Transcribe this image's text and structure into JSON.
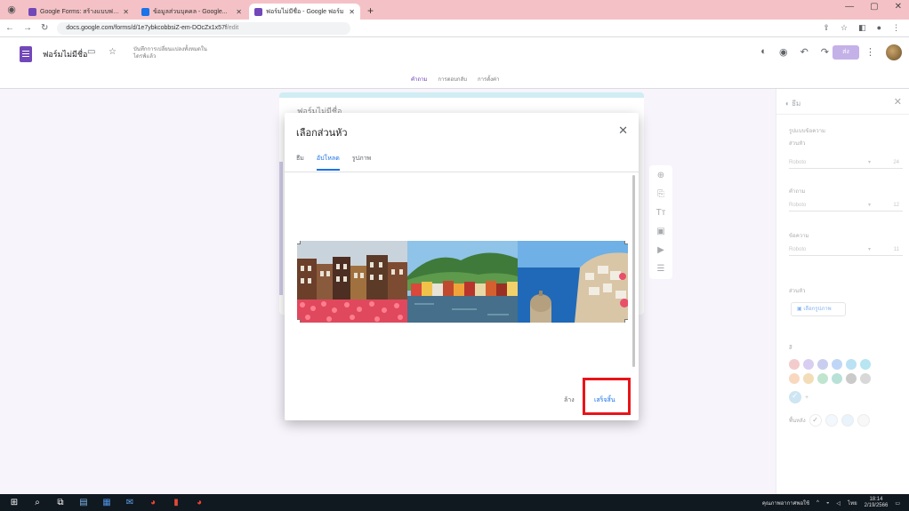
{
  "browser": {
    "tabs": [
      {
        "title": "Google Forms: สร้างแบบฟอร์ม...",
        "active": false
      },
      {
        "title": "ข้อมูลส่วนบุคคล - Google...",
        "active": false
      },
      {
        "title": "ฟอร์มไม่มีชื่อ - Google ฟอร์ม",
        "active": true
      }
    ],
    "url": "docs.google.com/forms/d/1e7ybkcobbsiZ-em-DOcZx1x57f",
    "url_rest": "/edit",
    "new_tab": "+",
    "win_minimize": "—",
    "win_maximize": "▢",
    "win_close": "✕"
  },
  "form_header": {
    "title": "ฟอร์มไม่มีชื่อ",
    "save_status": "บันทึกการเปลี่ยนแปลงทั้งหมดในไดรฟ์แล้ว",
    "send_label": "ส่ง",
    "mode_tabs": [
      {
        "label": "คำถาม",
        "selected": true
      },
      {
        "label": "การตอบกลับ",
        "selected": false
      },
      {
        "label": "การตั้งค่า",
        "selected": false
      }
    ]
  },
  "canvas": {
    "form_title": "ฟอร์มไม่มีชื่อ"
  },
  "theme_panel": {
    "title": "ธีม",
    "style_label": "รูปแบบข้อความ",
    "header_label": "ส่วนหัว",
    "question_label": "คำถาม",
    "text_label": "ข้อความ",
    "font_value": "Roboto",
    "header_size": "24",
    "question_size": "12",
    "text_size": "11",
    "header_image_label": "ส่วนหัว",
    "choose_image_label": "เลือกรูปภาพ",
    "color_label": "สี",
    "background_label": "พื้นหลัง",
    "add_color": "+",
    "swatches": [
      "#e8a2a2",
      "#b9a6e6",
      "#9fa7e0",
      "#8ab4f0",
      "#82c8ec",
      "#7dd0e6",
      "#f2b98a",
      "#e9c27a",
      "#8cd0a8",
      "#7ec8b8",
      "#9e9e9e",
      "#b8b8b8"
    ],
    "selected_swatch": "#a6d0ea",
    "backgrounds": [
      "#ffffff",
      "#e8f2fb",
      "#d6e9f8",
      "#f3f3f3"
    ]
  },
  "dialog": {
    "title": "เลือกส่วนหัว",
    "close": "✕",
    "tabs": [
      {
        "label": "ธีม",
        "selected": false
      },
      {
        "label": "อัปโหลด",
        "selected": true
      },
      {
        "label": "รูปภาพ",
        "selected": false
      }
    ],
    "cancel_label": "ล้าง",
    "done_label": "เสร็จสิ้น"
  },
  "taskbar": {
    "tray_text": "คุณภาพอากาศพอใช้",
    "time": "18:14",
    "date": "2/19/2566",
    "lang": "ไทย"
  }
}
